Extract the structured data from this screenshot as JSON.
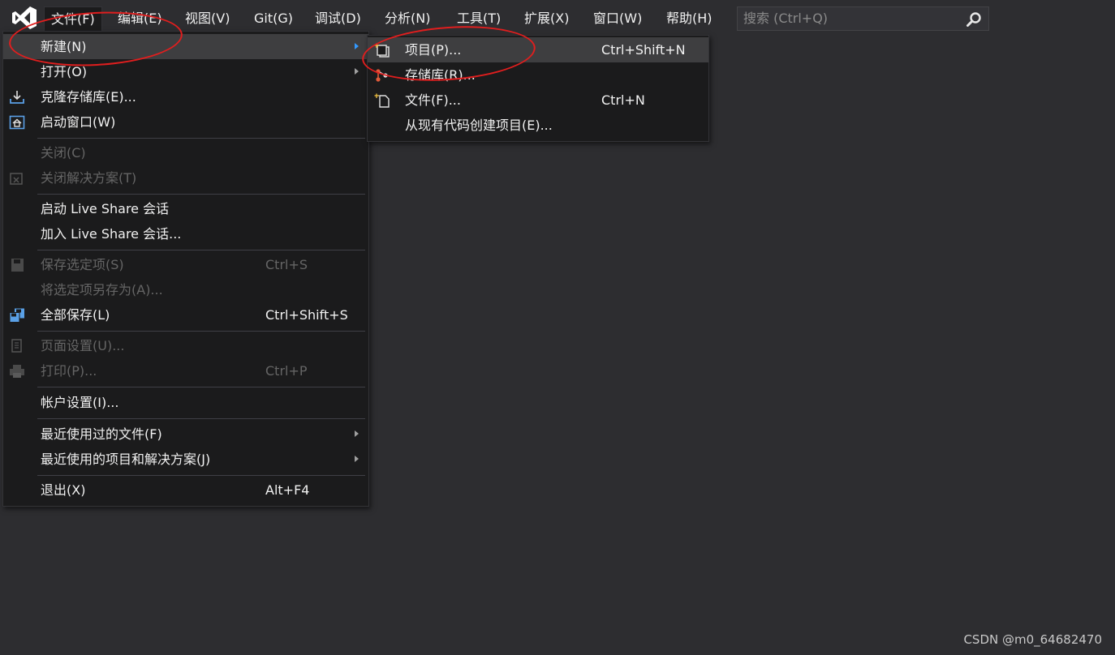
{
  "menubar": {
    "items": [
      {
        "label": "文件(F)"
      },
      {
        "label": "编辑(E)"
      },
      {
        "label": "视图(V)"
      },
      {
        "label": "Git(G)"
      },
      {
        "label": "调试(D)"
      },
      {
        "label": "分析(N)"
      },
      {
        "label": "工具(T)"
      },
      {
        "label": "扩展(X)"
      },
      {
        "label": "窗口(W)"
      },
      {
        "label": "帮助(H)"
      }
    ],
    "search_placeholder": "搜索 (Ctrl+Q)"
  },
  "file_menu": {
    "items": [
      {
        "label": "新建(N)",
        "shortcut": ""
      },
      {
        "label": "打开(O)",
        "shortcut": ""
      },
      {
        "label": "克隆存储库(E)...",
        "shortcut": ""
      },
      {
        "label": "启动窗口(W)",
        "shortcut": ""
      },
      {
        "label": "关闭(C)",
        "shortcut": ""
      },
      {
        "label": "关闭解决方案(T)",
        "shortcut": ""
      },
      {
        "label": "启动 Live Share 会话",
        "shortcut": ""
      },
      {
        "label": "加入 Live Share 会话...",
        "shortcut": ""
      },
      {
        "label": "保存选定项(S)",
        "shortcut": "Ctrl+S"
      },
      {
        "label": "将选定项另存为(A)...",
        "shortcut": ""
      },
      {
        "label": "全部保存(L)",
        "shortcut": "Ctrl+Shift+S"
      },
      {
        "label": "页面设置(U)...",
        "shortcut": ""
      },
      {
        "label": "打印(P)...",
        "shortcut": "Ctrl+P"
      },
      {
        "label": "帐户设置(I)...",
        "shortcut": ""
      },
      {
        "label": "最近使用过的文件(F)",
        "shortcut": ""
      },
      {
        "label": "最近使用的项目和解决方案(J)",
        "shortcut": ""
      },
      {
        "label": "退出(X)",
        "shortcut": "Alt+F4"
      }
    ]
  },
  "new_submenu": {
    "items": [
      {
        "label": "项目(P)...",
        "shortcut": "Ctrl+Shift+N"
      },
      {
        "label": "存储库(R)...",
        "shortcut": ""
      },
      {
        "label": "文件(F)...",
        "shortcut": "Ctrl+N"
      },
      {
        "label": "从现有代码创建项目(E)...",
        "shortcut": ""
      }
    ]
  },
  "watermark": "CSDN @m0_64682470",
  "colors": {
    "background": "#2d2d30",
    "menu_background": "#1b1b1c",
    "highlight": "#3e3e40",
    "accent": "#3399ff",
    "vs_purple": "#ffffff",
    "annotation_red": "#e01e1e"
  }
}
